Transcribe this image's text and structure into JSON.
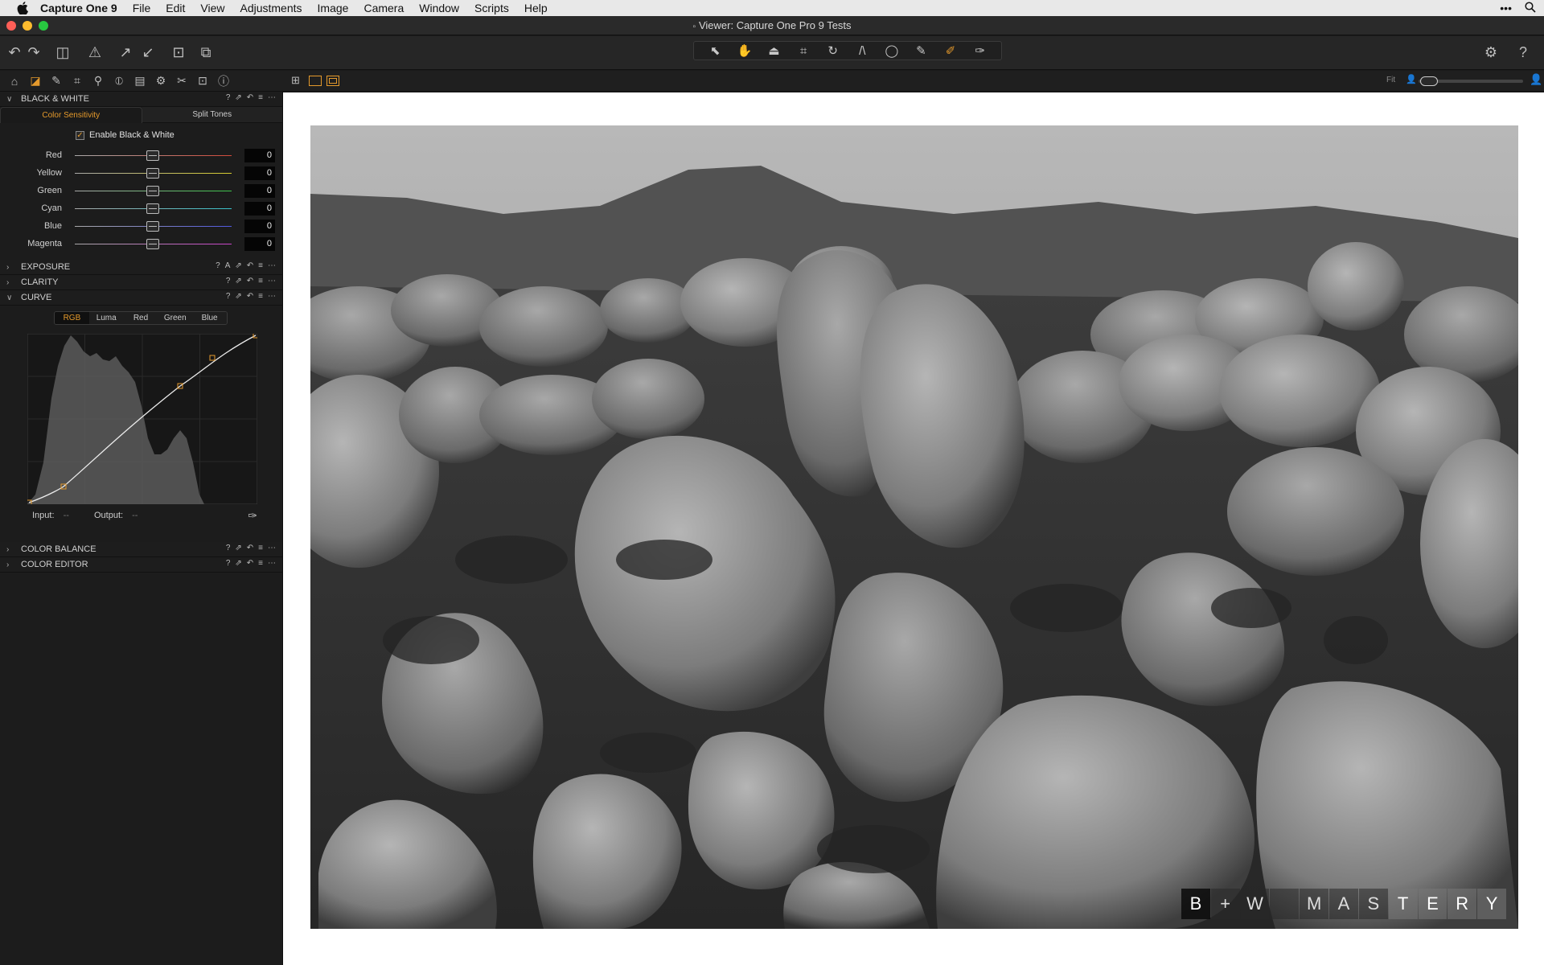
{
  "menubar": {
    "app_name": "Capture One 9",
    "items": [
      "File",
      "Edit",
      "View",
      "Adjustments",
      "Image",
      "Camera",
      "Window",
      "Scripts",
      "Help"
    ]
  },
  "window": {
    "title": "Viewer: Capture One Pro 9 Tests"
  },
  "colors": {
    "accent": "#e59a2c",
    "close": "#ff5f57",
    "minimize": "#febc2e",
    "zoom": "#28c840"
  },
  "black_white": {
    "title": "BLACK & WHITE",
    "tabs": [
      "Color Sensitivity",
      "Split Tones"
    ],
    "enable_label": "Enable Black & White",
    "enabled": true,
    "sliders": [
      {
        "label": "Red",
        "value": "0",
        "color": "#d14a3a"
      },
      {
        "label": "Yellow",
        "value": "0",
        "color": "#d6cb2e"
      },
      {
        "label": "Green",
        "value": "0",
        "color": "#3cc24a"
      },
      {
        "label": "Cyan",
        "value": "0",
        "color": "#38c0c8"
      },
      {
        "label": "Blue",
        "value": "0",
        "color": "#5058e0"
      },
      {
        "label": "Magenta",
        "value": "0",
        "color": "#c843c8"
      }
    ]
  },
  "tools": {
    "exposure": "EXPOSURE",
    "clarity": "CLARITY",
    "curve": "CURVE",
    "color_balance": "COLOR BALANCE",
    "color_editor": "COLOR EDITOR"
  },
  "curve": {
    "tabs": [
      "RGB",
      "Luma",
      "Red",
      "Green",
      "Blue"
    ],
    "active_tab": "RGB",
    "input_label": "Input:",
    "input_value": "--",
    "output_label": "Output:",
    "output_value": "--"
  },
  "viewer": {
    "fit_label": "Fit"
  },
  "watermark": {
    "letters": [
      "B",
      "+",
      "W",
      "",
      "M",
      "A",
      "S",
      "T",
      "E",
      "R",
      "Y"
    ]
  }
}
